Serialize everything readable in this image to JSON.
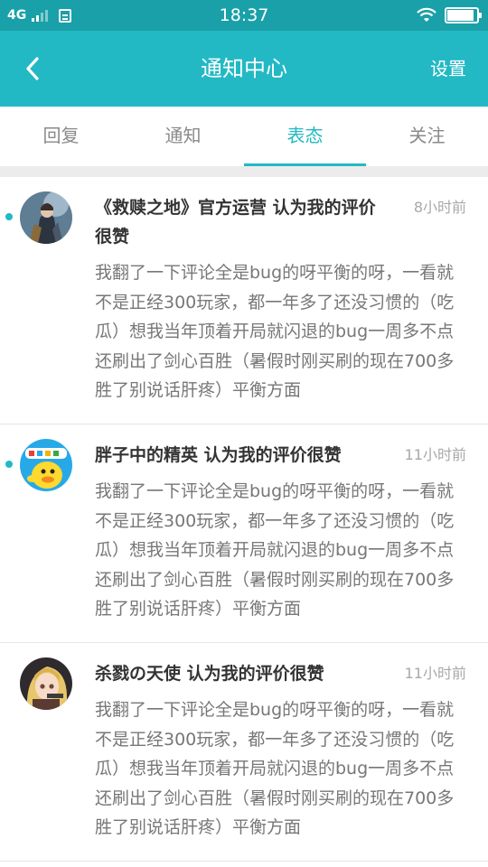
{
  "status_bar": {
    "network": "4G",
    "time": "18:37",
    "battery_level": 0.9
  },
  "header": {
    "back_icon": "chevron-left-icon",
    "title": "通知中心",
    "settings_label": "设置"
  },
  "tabs": [
    {
      "label": "回复",
      "active": false
    },
    {
      "label": "通知",
      "active": false
    },
    {
      "label": "表态",
      "active": true
    },
    {
      "label": "关注",
      "active": false
    }
  ],
  "colors": {
    "accent": "#22b9c4",
    "status_bar": "#1aa0a8",
    "title_text": "#333333",
    "body_text": "#777777",
    "time_text": "#a8a8a8"
  },
  "items": [
    {
      "unread": true,
      "avatar": "knight-avatar",
      "title": "《救赎之地》官方运营 认为我的评价很赞",
      "time": "8小时前",
      "body": "我翻了一下评论全是bug的呀平衡的呀，一看就不是正经300玩家，都一年多了还没习惯的（吃瓜）想我当年顶着开局就闪退的bug一周多不点还刷出了剑心百胜（暑假时刚买刷的现在700多胜了别说话肝疼）平衡方面"
    },
    {
      "unread": true,
      "avatar": "yellow-duck-avatar",
      "title": "胖子中的精英 认为我的评价很赞",
      "time": "11小时前",
      "body": "我翻了一下评论全是bug的呀平衡的呀，一看就不是正经300玩家，都一年多了还没习惯的（吃瓜）想我当年顶着开局就闪退的bug一周多不点还刷出了剑心百胜（暑假时刚买刷的现在700多胜了别说话肝疼）平衡方面"
    },
    {
      "unread": false,
      "avatar": "anime-girl-avatar",
      "title": "杀戮の天使 认为我的评价很赞",
      "time": "11小时前",
      "body": "我翻了一下评论全是bug的呀平衡的呀，一看就不是正经300玩家，都一年多了还没习惯的（吃瓜）想我当年顶着开局就闪退的bug一周多不点还刷出了剑心百胜（暑假时刚买刷的现在700多胜了别说话肝疼）平衡方面"
    }
  ]
}
